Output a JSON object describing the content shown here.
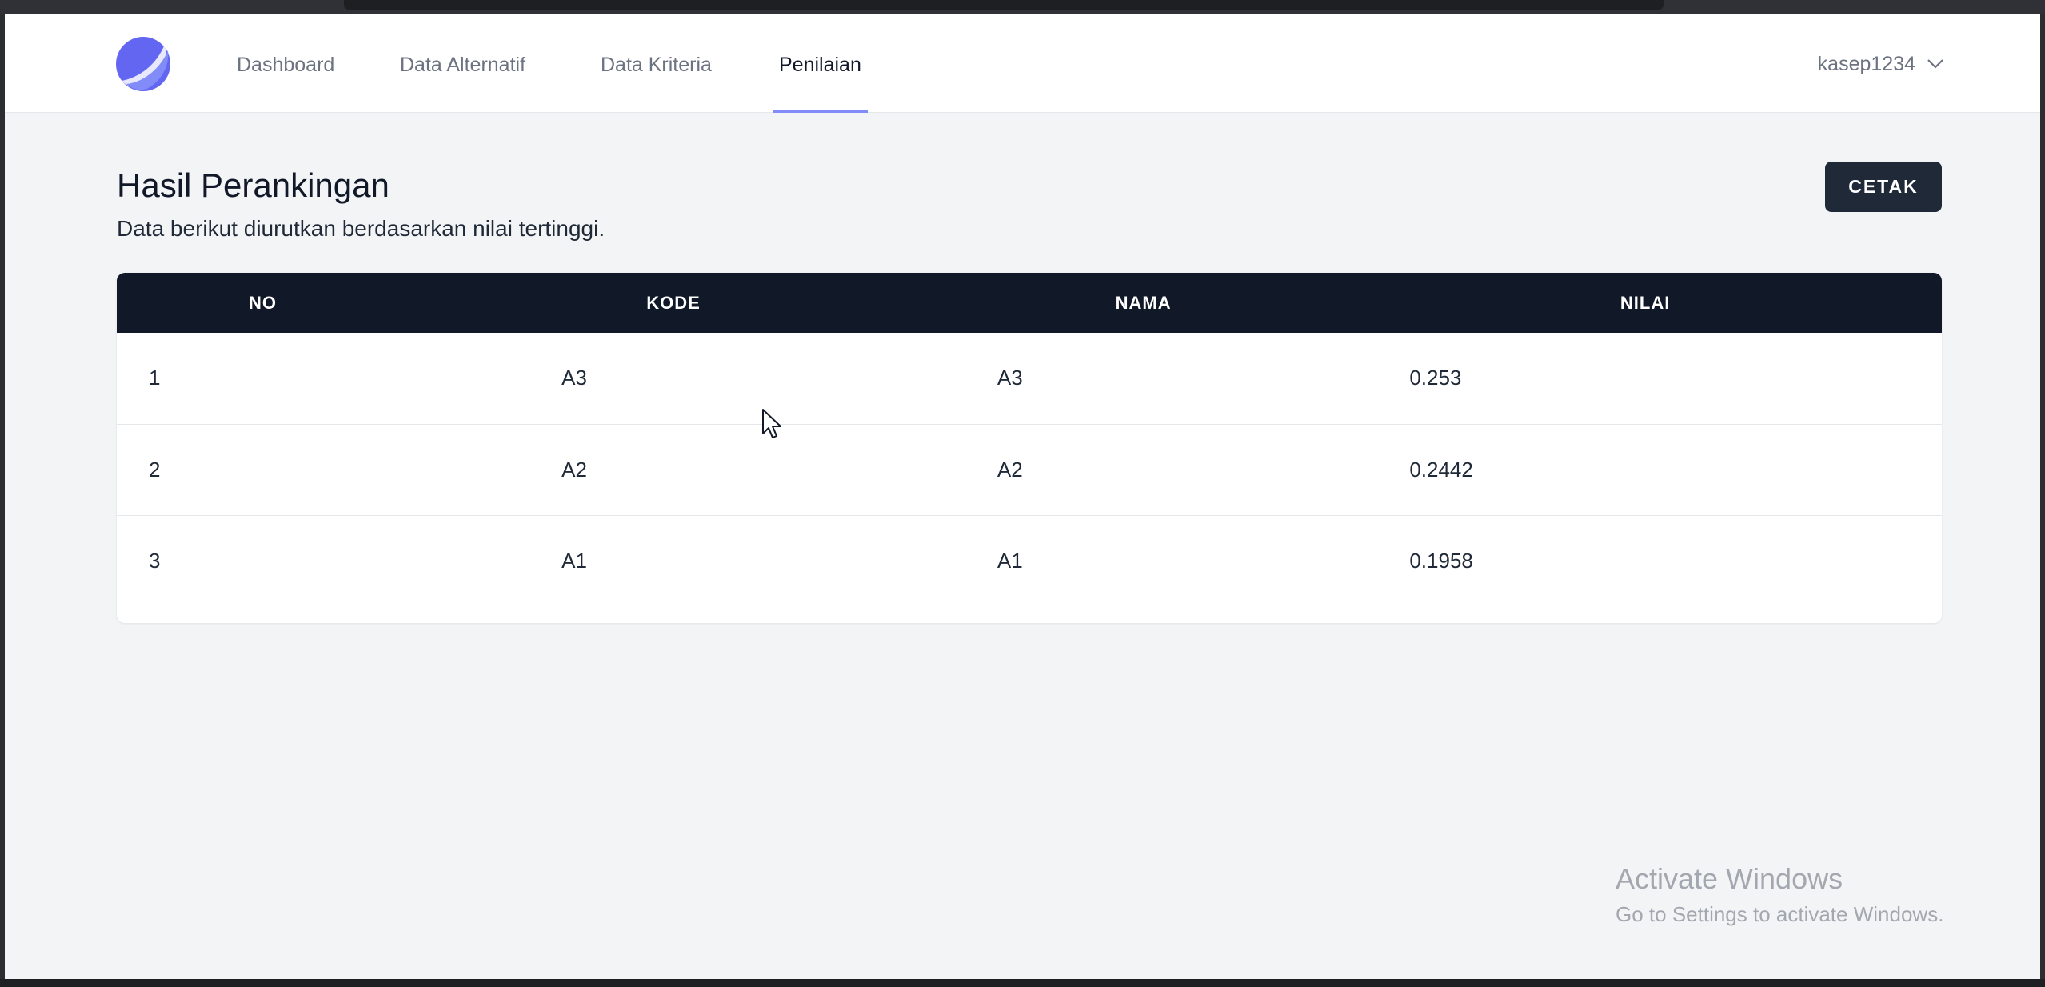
{
  "nav": {
    "links": [
      {
        "label": "Dashboard",
        "active": false
      },
      {
        "label": "Data Alternatif",
        "active": false
      },
      {
        "label": "Data Kriteria",
        "active": false
      },
      {
        "label": "Penilaian",
        "active": true
      }
    ],
    "user": "kasep1234",
    "accent_color": "#818cf8",
    "logo_color": "#6366f1"
  },
  "page": {
    "title": "Hasil Perankingan",
    "subtitle": "Data berikut diurutkan berdasarkan nilai tertinggi.",
    "print_button": "CETAK"
  },
  "table": {
    "headers": [
      "NO",
      "KODE",
      "NAMA",
      "NILAI"
    ],
    "rows": [
      {
        "no": "1",
        "kode": "A3",
        "nama": "A3",
        "nilai": "0.253"
      },
      {
        "no": "2",
        "kode": "A2",
        "nama": "A2",
        "nilai": "0.2442"
      },
      {
        "no": "3",
        "kode": "A1",
        "nama": "A1",
        "nilai": "0.1958"
      }
    ]
  },
  "watermark": {
    "line1": "Activate Windows",
    "line2": "Go to Settings to activate Windows."
  },
  "icons": {
    "logo": "crescent-logo-icon",
    "user_menu": "chevron-down-icon",
    "cursor": "mouse-pointer-icon"
  }
}
